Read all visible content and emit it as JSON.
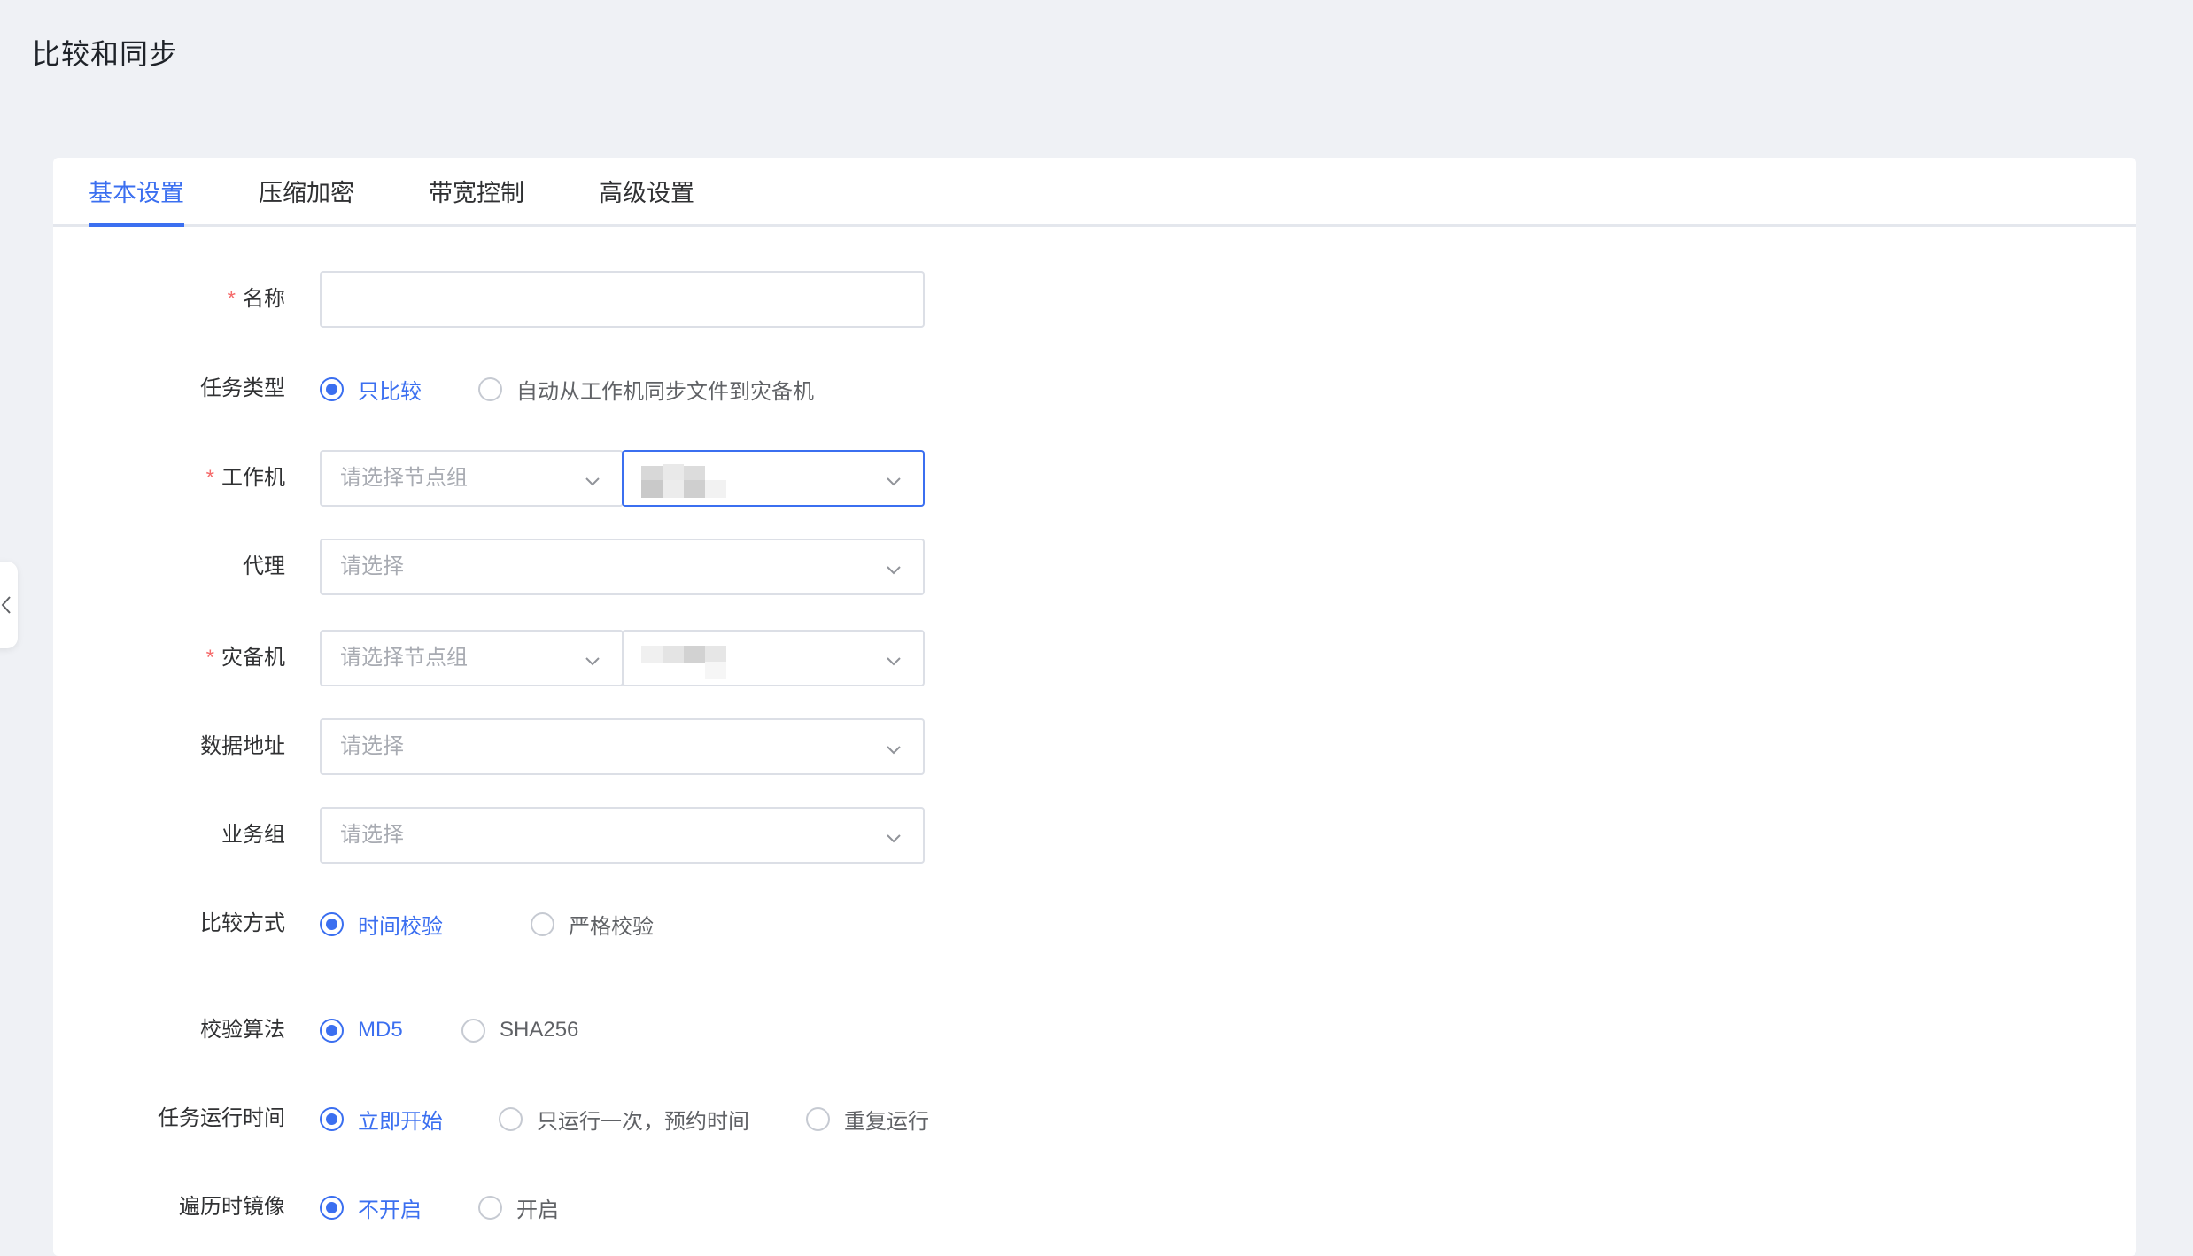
{
  "page": {
    "title": "比较和同步"
  },
  "tabs": [
    {
      "label": "基本设置",
      "active": true
    },
    {
      "label": "压缩加密",
      "active": false
    },
    {
      "label": "带宽控制",
      "active": false
    },
    {
      "label": "高级设置",
      "active": false
    }
  ],
  "form": {
    "name": {
      "label": "名称",
      "required": true,
      "value": ""
    },
    "task_type": {
      "label": "任务类型",
      "options": [
        "只比较",
        "自动从工作机同步文件到灾备机"
      ],
      "selected": "只比较"
    },
    "work_machine": {
      "label": "工作机",
      "required": true,
      "group_placeholder": "请选择节点组",
      "node_value_blurred": true
    },
    "proxy": {
      "label": "代理",
      "placeholder": "请选择"
    },
    "backup_machine": {
      "label": "灾备机",
      "required": true,
      "group_placeholder": "请选择节点组",
      "node_value_blurred": true
    },
    "data_address": {
      "label": "数据地址",
      "placeholder": "请选择"
    },
    "business_group": {
      "label": "业务组",
      "placeholder": "请选择"
    },
    "compare_method": {
      "label": "比较方式",
      "options": [
        "时间校验",
        "严格校验"
      ],
      "selected": "时间校验"
    },
    "checksum_algorithm": {
      "label": "校验算法",
      "options": [
        "MD5",
        "SHA256"
      ],
      "selected": "MD5"
    },
    "run_time": {
      "label": "任务运行时间",
      "options": [
        "立即开始",
        "只运行一次，预约时间",
        "重复运行"
      ],
      "selected": "立即开始"
    },
    "traverse_mirror": {
      "label": "遍历时镜像",
      "options": [
        "不开启",
        "开启"
      ],
      "selected": "不开启"
    }
  },
  "required_mark": "*",
  "colors": {
    "accent": "#3b6ff0",
    "required": "#f56c6c",
    "background": "#eff1f5"
  },
  "icons": {
    "select_arrow": "chevron-down-icon",
    "sidebar_toggle": "chevron-left-icon"
  }
}
